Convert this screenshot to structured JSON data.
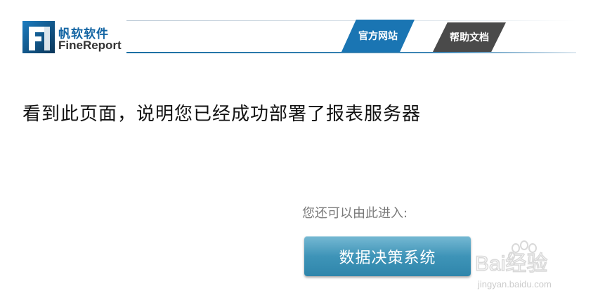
{
  "header": {
    "logo_cn": "帆软软件",
    "logo_en": "FineReport",
    "tabs": [
      {
        "label": "官方网站"
      },
      {
        "label": "帮助文档"
      }
    ]
  },
  "main": {
    "message": "看到此页面，说明您已经成功部署了报表服务器",
    "hint": "您还可以由此进入:",
    "button_label": "数据决策系统"
  },
  "watermark": {
    "text": "Bai经验",
    "url": "jingyan.baidu.com"
  },
  "colors": {
    "brand_blue": "#1a75b3",
    "tab_dark": "#4a4a4a",
    "button_blue": "#3e94b8"
  }
}
